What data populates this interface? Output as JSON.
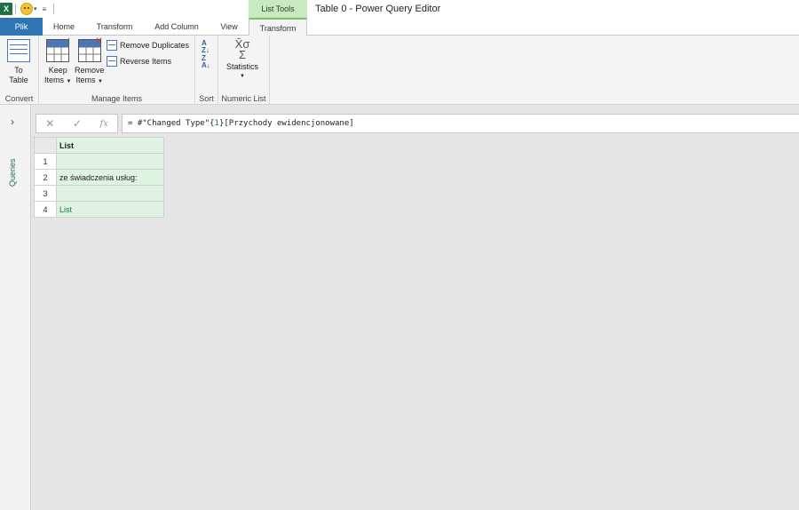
{
  "window": {
    "title": "Table 0 - Power Query Editor",
    "context_tab_group": "List Tools",
    "excel_icon_letter": "X"
  },
  "tabs": [
    {
      "label": "Plik"
    },
    {
      "label": "Home"
    },
    {
      "label": "Transform"
    },
    {
      "label": "Add Column"
    },
    {
      "label": "View"
    },
    {
      "label": "Transform"
    }
  ],
  "ribbon": {
    "convert": {
      "to_table_label_1": "To",
      "to_table_label_2": "Table",
      "group_label": "Convert"
    },
    "manage": {
      "keep_label_1": "Keep",
      "keep_label_2": "Items",
      "remove_label_1": "Remove",
      "remove_label_2": "Items",
      "remove_duplicates": "Remove Duplicates",
      "reverse_items": "Reverse Items",
      "group_label": "Manage Items"
    },
    "sort": {
      "group_label": "Sort"
    },
    "numeric": {
      "statistics_label": "Statistics",
      "group_label": "Numeric List"
    }
  },
  "queries_pane": {
    "label": "Queries"
  },
  "formula_bar": {
    "prefix": "= #\"Changed Type\"{",
    "index": "1",
    "suffix": "}[Przychody ewidencjonowane]"
  },
  "grid": {
    "header": "List",
    "rows": [
      {
        "num": "1",
        "value": ""
      },
      {
        "num": "2",
        "value": "ze świadczenia usług:"
      },
      {
        "num": "3",
        "value": ""
      },
      {
        "num": "4",
        "value": "List"
      }
    ]
  },
  "colors": {
    "file_tab": "#2e75b6",
    "context_header": "#c8eac1",
    "cell_fill": "#dff3e2",
    "queries_text": "#217346"
  }
}
